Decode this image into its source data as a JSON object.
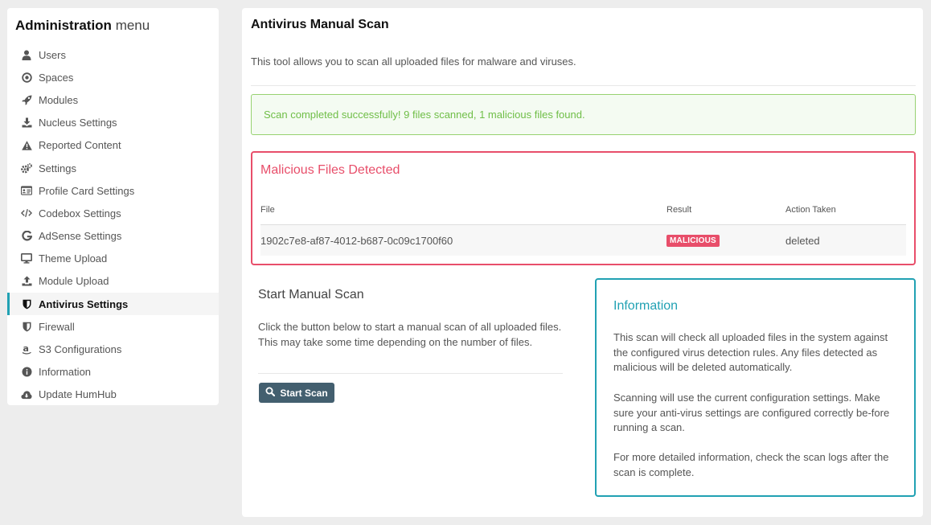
{
  "sidebar": {
    "title": "Administration",
    "title_suffix": "menu",
    "items": [
      {
        "label": "Users",
        "icon": "user-icon"
      },
      {
        "label": "Spaces",
        "icon": "dot-circle-icon"
      },
      {
        "label": "Modules",
        "icon": "rocket-icon"
      },
      {
        "label": "Nucleus Settings",
        "icon": "download-icon"
      },
      {
        "label": "Reported Content",
        "icon": "warning-icon"
      },
      {
        "label": "Settings",
        "icon": "gears-icon"
      },
      {
        "label": "Profile Card Settings",
        "icon": "id-card-icon"
      },
      {
        "label": "Codebox Settings",
        "icon": "code-icon"
      },
      {
        "label": "AdSense Settings",
        "icon": "google-icon"
      },
      {
        "label": "Theme Upload",
        "icon": "desktop-icon"
      },
      {
        "label": "Module Upload",
        "icon": "upload-icon"
      },
      {
        "label": "Antivirus Settings",
        "icon": "shield-icon",
        "active": true
      },
      {
        "label": "Firewall",
        "icon": "shield-icon"
      },
      {
        "label": "S3 Configurations",
        "icon": "amazon-icon"
      },
      {
        "label": "Information",
        "icon": "info-circle-icon"
      },
      {
        "label": "Update HumHub",
        "icon": "cloud-download-icon"
      }
    ]
  },
  "main": {
    "title": "Antivirus Manual Scan",
    "description": "This tool allows you to scan all uploaded files for malware and viruses.",
    "success_message": "Scan completed successfully! 9 files scanned, 1 malicious files found.",
    "malicious": {
      "title": "Malicious Files Detected",
      "headers": {
        "file": "File",
        "result": "Result",
        "action": "Action Taken"
      },
      "rows": [
        {
          "file": "1902c7e8-af87-4012-b687-0c09c1700f60",
          "result": "MALICIOUS",
          "action": "deleted"
        }
      ]
    },
    "scan": {
      "title": "Start Manual Scan",
      "description": "Click the button below to start a manual scan of all uploaded files. This may take some time depending on the number of files.",
      "button_label": "Start Scan"
    },
    "info": {
      "title": "Information",
      "paragraphs": [
        "This scan will check all uploaded files in the system against the configured virus detection rules. Any files detected as malicious will be deleted automatically.",
        "Scanning will use the current configuration settings. Make sure your anti-virus settings are configured correctly be-fore running a scan.",
        "For more detailed information, check the scan logs after the scan is complete."
      ]
    }
  },
  "colors": {
    "accent": "#21a1b3",
    "danger": "#e84e6a",
    "success": "#6fbe47",
    "button": "#435f6f"
  }
}
